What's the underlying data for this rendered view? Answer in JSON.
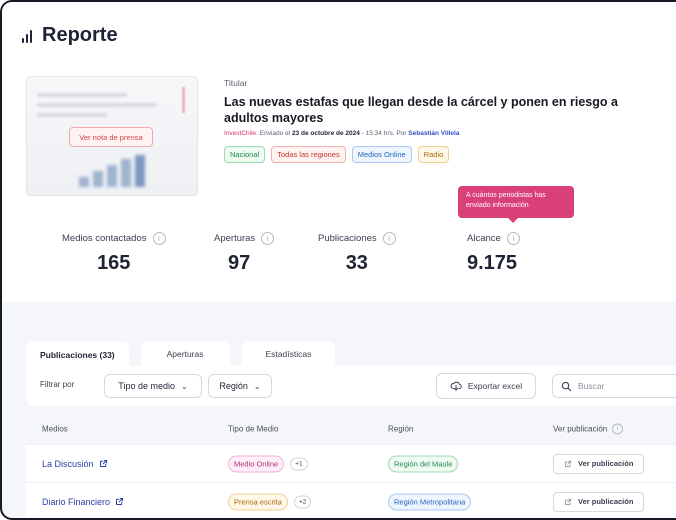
{
  "page": {
    "title": "Reporte"
  },
  "release": {
    "thumbnail_button": "Ver nota de prensa",
    "label": "Titular",
    "headline": "Las nuevas estafas que llegan desde la cárcel y ponen en riesgo a adultos mayores",
    "meta": {
      "org": "InvestChile",
      "sent_prefix": ". Enviado el ",
      "date": "23 de octubre de 2024",
      "time_text": " - 15:34 hrs. Por ",
      "author": "Sebastián Villela"
    },
    "tags": [
      {
        "label": "Nacional",
        "color": "#1f8a4c",
        "bg": "#effaf2",
        "border": "#9fd9b3"
      },
      {
        "label": "Todas las regiones",
        "color": "#c0392b",
        "bg": "#fff2f0",
        "border": "#f0b3ab"
      },
      {
        "label": "Medios Online",
        "color": "#2368b5",
        "bg": "#eef5ff",
        "border": "#a9c8ef"
      },
      {
        "label": "Radio",
        "color": "#a8660c",
        "bg": "#fff7e8",
        "border": "#efcf92"
      }
    ]
  },
  "tooltip": {
    "text": "A cuántos periodistas has enviado información",
    "color": "#d94079"
  },
  "stats": [
    {
      "label": "Medios contactados",
      "value": "165"
    },
    {
      "label": "Aperturas",
      "value": "97"
    },
    {
      "label": "Publicaciones",
      "value": "33"
    },
    {
      "label": "Alcance",
      "value": "9.175"
    }
  ],
  "tabs": [
    {
      "label": "Publicaciones (33)",
      "active": true
    },
    {
      "label": "Aperturas",
      "active": false
    },
    {
      "label": "Estadísticas",
      "active": false
    }
  ],
  "filters": {
    "label": "Filtrar por",
    "media_type": "Tipo de medio",
    "region": "Región",
    "export": "Exportar excel",
    "search_placeholder": "Buscar"
  },
  "table": {
    "headers": [
      "Medios",
      "Tipo de Medio",
      "Región",
      "Ver publicación"
    ],
    "rows": [
      {
        "media": "La Discusión",
        "type": "Medio Online",
        "type_color": "#b0307a",
        "type_bg": "#fdeef7",
        "type_border": "#efb0d6",
        "extra": "+1",
        "region": "Región del Maule",
        "region_color": "#1f8a4c",
        "region_bg": "#effaf2",
        "region_border": "#9fd9b3",
        "action": "Ver publicación"
      },
      {
        "media": "Diario Financiero",
        "type": "Prensa escrita",
        "type_color": "#a8660c",
        "type_bg": "#fff7e8",
        "type_border": "#efcf92",
        "extra": "+2",
        "region": "Región Metropolitana",
        "region_color": "#2368b5",
        "region_bg": "#eef5ff",
        "region_border": "#a9c8ef",
        "action": "Ver publicación"
      }
    ]
  }
}
